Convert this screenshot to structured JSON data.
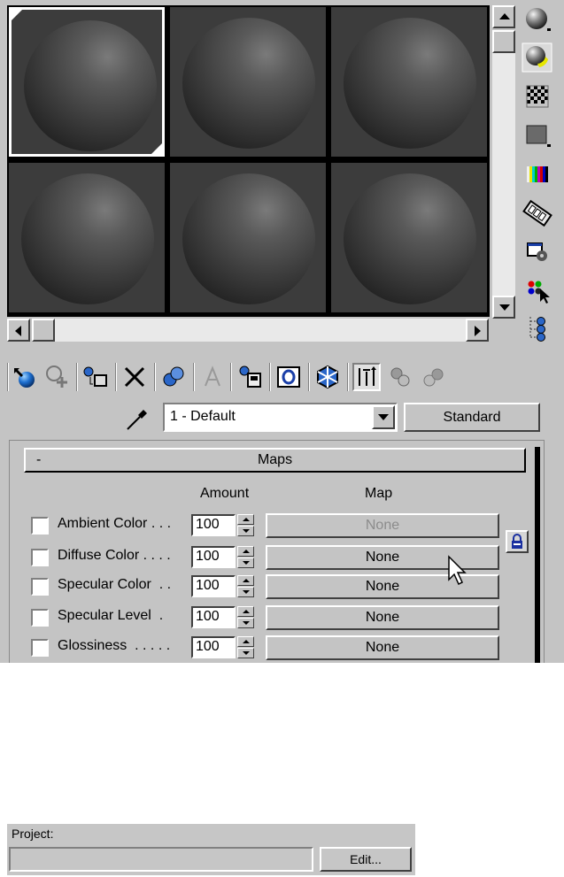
{
  "material_editor": {
    "sample_slots": [
      {
        "name": "slot-1",
        "active": true
      },
      {
        "name": "slot-2",
        "active": false
      },
      {
        "name": "slot-3",
        "active": false
      },
      {
        "name": "slot-4",
        "active": false
      },
      {
        "name": "slot-5",
        "active": false
      },
      {
        "name": "slot-6",
        "active": false
      }
    ],
    "side_tools": [
      "sample-type-icon",
      "backlight-icon",
      "background-checker-icon",
      "sample-uv-tiling-icon",
      "video-color-check-icon",
      "make-preview-icon",
      "options-icon",
      "select-by-material-icon",
      "material-map-navigator-icon"
    ],
    "toolbar": [
      "get-material-icon",
      "put-to-scene-icon",
      "assign-to-selection-icon",
      "reset-map-icon",
      "make-unique-icon",
      "put-to-library-icon",
      "material-effects-channel-icon",
      "show-map-in-viewport-icon",
      "show-end-result-icon",
      "go-to-parent-icon",
      "go-forward-to-sibling-icon"
    ],
    "material_name": "1 - Default",
    "material_type": "Standard",
    "maps_rollout": {
      "collapse_symbol": "-",
      "title": "Maps",
      "amount_header": "Amount",
      "map_header": "Map",
      "rows": [
        {
          "label": "Ambient Color . . .",
          "amount": "100",
          "map": "None",
          "map_disabled": true
        },
        {
          "label": "Diffuse Color . . . .",
          "amount": "100",
          "map": "None",
          "map_disabled": false
        },
        {
          "label": "Specular Color  . .",
          "amount": "100",
          "map": "None",
          "map_disabled": false
        },
        {
          "label": "Specular Level  .",
          "amount": "100",
          "map": "None",
          "map_disabled": false
        },
        {
          "label": "Glossiness  . . . . .",
          "amount": "100",
          "map": "None",
          "map_disabled": false
        }
      ]
    }
  },
  "project": {
    "label": "Project:",
    "value": "",
    "edit_button": "Edit..."
  }
}
